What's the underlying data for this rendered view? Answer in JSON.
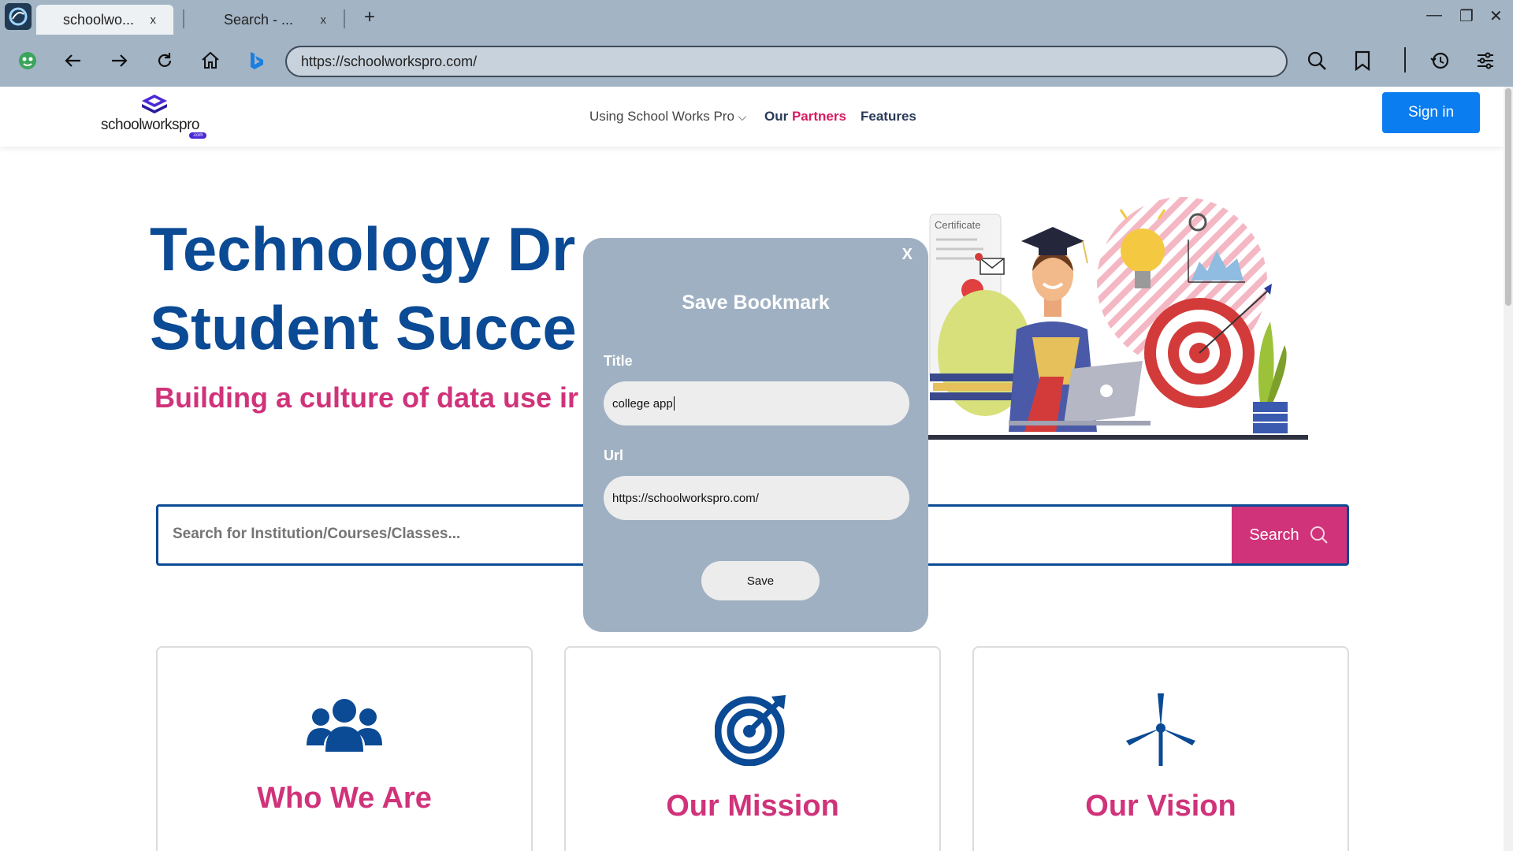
{
  "browser": {
    "tabs": [
      {
        "title": "schoolwo...",
        "close": "x",
        "active": true
      },
      {
        "title": "Search - ...",
        "close": "x",
        "active": false
      }
    ],
    "new_tab": "+",
    "url": "https://schoolworkspro.com/",
    "window_controls": {
      "minimize": "—",
      "restore": "❐",
      "close": "✕"
    },
    "icons": [
      "app-icon",
      "profile-icon",
      "back-icon",
      "forward-icon",
      "refresh-icon",
      "home-icon",
      "bing-icon",
      "search-icon",
      "bookmark-icon",
      "history-icon",
      "settings-icon"
    ]
  },
  "site": {
    "logo_text": "schoolworkspro",
    "logo_sub": ".com",
    "nav": {
      "using": "Using School Works Pro",
      "using_chevron": "⌵",
      "our": "Our",
      "partners": "Partners",
      "features": "Features"
    },
    "signin": "Sign in",
    "hero": {
      "title_line1": "Technology Dr",
      "title_line2": "Student Succe",
      "subtitle": "Building a culture of data use ir"
    },
    "search": {
      "placeholder": "Search for Institution/Courses/Classes...",
      "button": "Search"
    },
    "illustration": {
      "certificate_text": "Certificate"
    },
    "cards": [
      {
        "title": "Who We Are",
        "icon": "users-icon"
      },
      {
        "title": "Our Mission",
        "icon": "target-icon"
      },
      {
        "title": "Our Vision",
        "icon": "wind-turbine-icon"
      }
    ],
    "colors": {
      "primary_blue": "#0b4a94",
      "accent_pink": "#d0337a",
      "signin_blue": "#0a7df0",
      "chrome": "#a3b4c5",
      "modal": "#9fb0c2"
    }
  },
  "modal": {
    "close": "X",
    "title": "Save Bookmark",
    "title_label": "Title",
    "title_value": "college app",
    "url_label": "Url",
    "url_value": "https://schoolworkspro.com/",
    "save": "Save"
  }
}
